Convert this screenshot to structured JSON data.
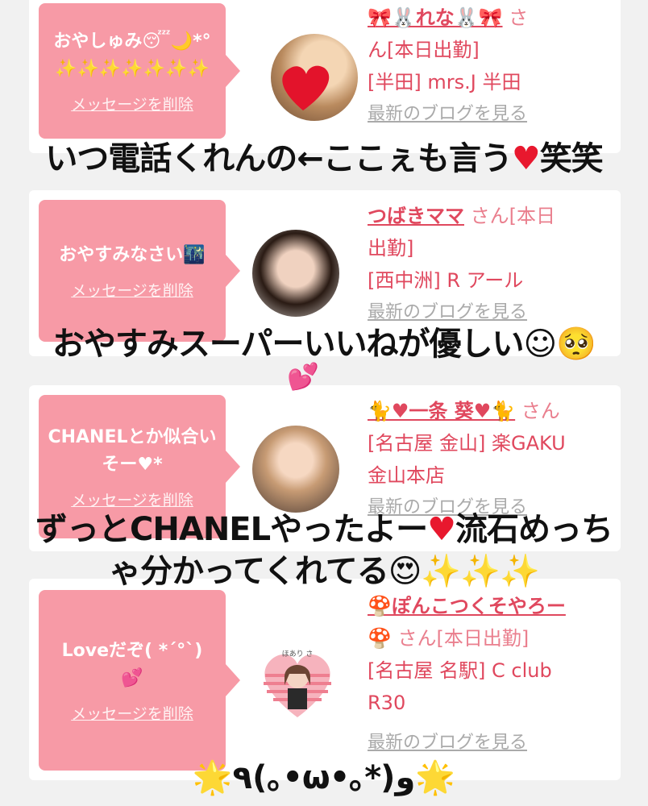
{
  "cards": [
    {
      "message": "おやしゅみ",
      "message_emoji": "😴🌙*°",
      "sparkles": "✨✨✨✨✨✨✨",
      "delete_label": "メッセージを削除",
      "name": "🎀🐰れな🐰🎀",
      "san": "さ",
      "line2": "ん[本日出勤]",
      "line3": "[半田] mrs.J 半田",
      "blog": "最新のブログを見る"
    },
    {
      "message": "おやすみなさい🌃",
      "delete_label": "メッセージを削除",
      "name": "つばきママ",
      "san": "さん[本日",
      "line2": "出勤]",
      "line3": "[西中洲] R アール",
      "blog": "最新のブログを見る"
    },
    {
      "message": "CHANELとか似合いそー♥*",
      "delete_label": "メッセージを削除",
      "name": "🐈♥一条 葵♥🐈",
      "san": "さん",
      "line2": "[名古屋 金山] 楽GAKU",
      "line3": "金山本店",
      "blog": "最新のブログを見る"
    },
    {
      "message": "Loveだぞ( *´°`)",
      "message_emoji": "💕",
      "delete_label": "メッセージを削除",
      "name": "🍄ぽんこつくそやろー",
      "name2": "🍄",
      "san": "さん[本日出勤]",
      "line2": "[名古屋 名駅] C club",
      "line3": "R30",
      "blog": "最新のブログを見る"
    }
  ],
  "avatar4_text": "ほあり さ",
  "captions": {
    "c1_a": "いつ電話くれんの←ここぇも言う",
    "c1_heart": "♥",
    "c1_b": "笑笑",
    "c2_a": "おやすみスーパーいいねが優しい",
    "c2_emoji": "☺🥺",
    "c2_hearts": "💕",
    "c3_a": "ずっとCHANELやったよー",
    "c3_heart": "♥",
    "c3_b": "流石めっち",
    "c4_a": "ゃ分かってくれてる",
    "c4_emoji": "😍✨✨✨",
    "c5_star1": "🌟",
    "c5_a": "٩(｡•ω•｡*)و",
    "c5_star2": "🌟"
  }
}
